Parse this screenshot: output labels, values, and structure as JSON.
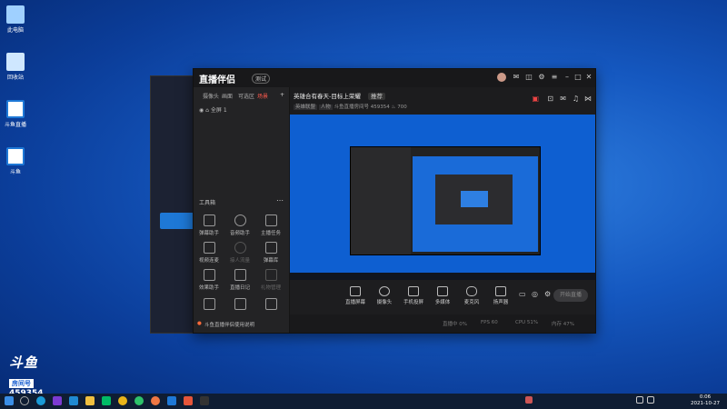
{
  "desktop": {
    "icons": [
      {
        "label": "此电脑",
        "color": "#9fd0ff"
      },
      {
        "label": "回收站",
        "color": "#cfe7ff"
      },
      {
        "label": "斗鱼直播",
        "color": "#1e78d6"
      },
      {
        "label": "斗鱼",
        "color": "#1e78d6"
      }
    ]
  },
  "main_window": {
    "app_name": "直播伴侣",
    "version_pill": "测试",
    "tabs": [
      "摄像头",
      "画面",
      "可选区",
      "场景"
    ],
    "active_tab_index": 3,
    "scene_label": "全屏 1",
    "tools_section": "工具箱",
    "tools": [
      {
        "label": "弹幕助手",
        "icon": "chat-icon"
      },
      {
        "label": "音频助手",
        "icon": "person-icon"
      },
      {
        "label": "主播任务",
        "icon": "clipboard-icon"
      },
      {
        "label": "视频连麦",
        "icon": "video-icon"
      },
      {
        "label": "接人流量",
        "icon": "download-icon",
        "dim": true
      },
      {
        "label": "弹幕库",
        "icon": "calendar-icon"
      },
      {
        "label": "效果助手",
        "icon": "document-icon"
      },
      {
        "label": "直播日记",
        "icon": "heart-icon"
      },
      {
        "label": "礼物管理",
        "icon": "gift-icon",
        "dim": true
      }
    ],
    "notice": "斗鱼直播伴侣使用说明",
    "stream_title": "英雄合有春天-目标上荣耀",
    "stream_tag": "推荐",
    "stream_sub": [
      "英雄联盟",
      "人物",
      "斗鱼直播房间号",
      "459354"
    ],
    "viewers": "700",
    "controls": [
      "直播屏幕",
      "摄像头",
      "手机投屏",
      "多媒体",
      "麦克风",
      "扬声器"
    ],
    "live_button": "开始直播",
    "status": [
      "直播中 0%",
      "FPS 60",
      "CPU 51%",
      "内存 47%"
    ]
  },
  "badge": {
    "logo": "斗鱼",
    "tag": "房间号",
    "room_number": "459354"
  },
  "taskbar": {
    "time": "0:06",
    "date": "2021-10-27"
  }
}
